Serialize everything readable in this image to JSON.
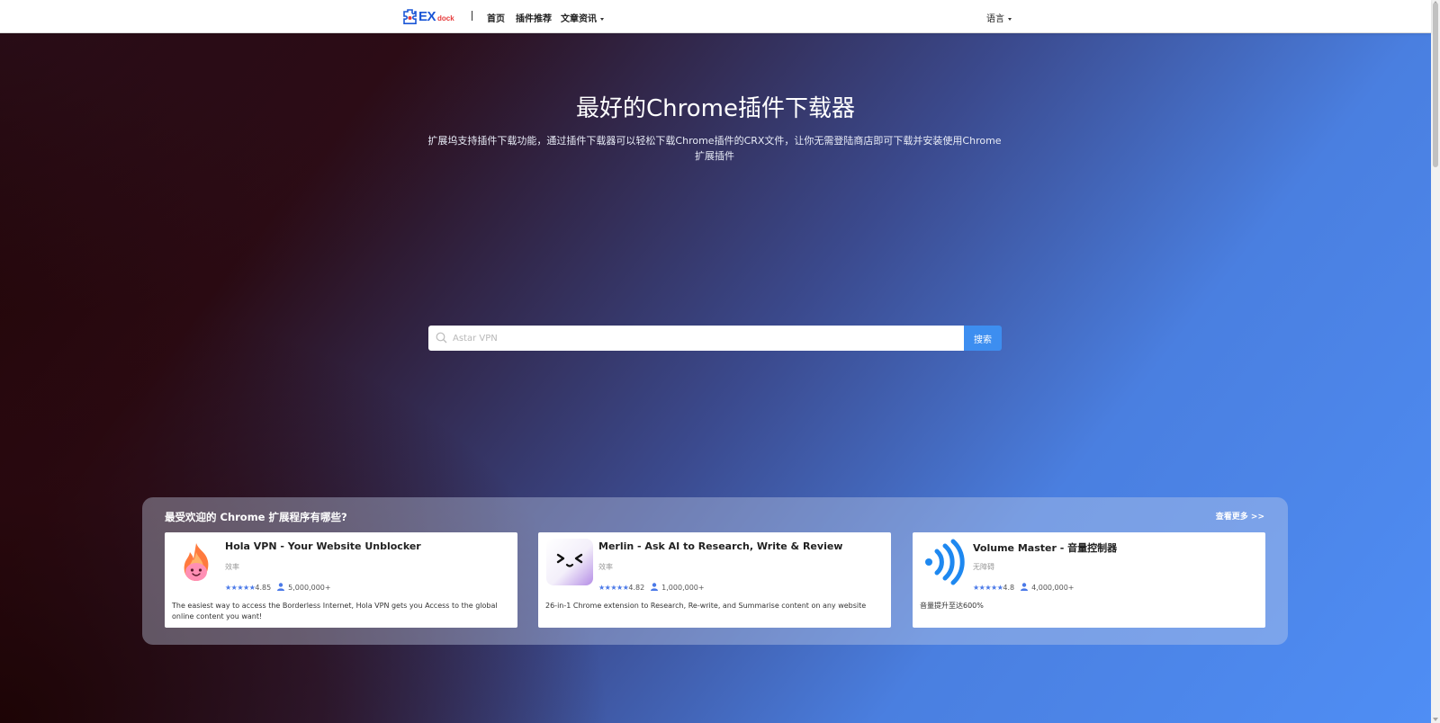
{
  "nav": {
    "logo_ex": "EX",
    "logo_dock": "dock",
    "home": "首页",
    "recommend": "插件推荐",
    "articles": "文章资讯",
    "language": "语言"
  },
  "hero": {
    "title": "最好的Chrome插件下载器",
    "subtitle": "扩展坞支持插件下载功能，通过插件下载器可以轻松下载Chrome插件的CRX文件，让你无需登陆商店即可下载并安装使用Chrome扩展插件"
  },
  "search": {
    "placeholder": "Astar VPN",
    "button_label": "搜索"
  },
  "popular": {
    "title": "最受欢迎的 Chrome 扩展程序有哪些?",
    "more_label": "查看更多 >>",
    "cards": [
      {
        "name": "Hola VPN - Your Website Unblocker",
        "category": "效率",
        "stars": "★★★★★",
        "rating": "4.85",
        "users": "5,000,000+",
        "description": "The easiest way to access the Borderless Internet, Hola VPN gets you Access to the global online content you want!",
        "icon": "flame-face-icon"
      },
      {
        "name": "Merlin - Ask AI to Research, Write & Review",
        "category": "效率",
        "stars": "★★★★★",
        "rating": "4.82",
        "users": "1,000,000+",
        "description": "26-in-1 Chrome extension to Research, Re-write, and Summarise content on any website",
        "icon": "merlin-face-icon"
      },
      {
        "name": "Volume Master - 音量控制器",
        "category": "无障碍",
        "stars": "★★★★★",
        "rating": "4.8",
        "users": "4,000,000+",
        "description": "音量提升至达600%",
        "icon": "sound-waves-icon"
      }
    ]
  },
  "colors": {
    "accent": "#3d8ef0",
    "star": "#4a79e8",
    "logo_blue": "#1a56d6",
    "logo_red": "#e63b3b"
  }
}
